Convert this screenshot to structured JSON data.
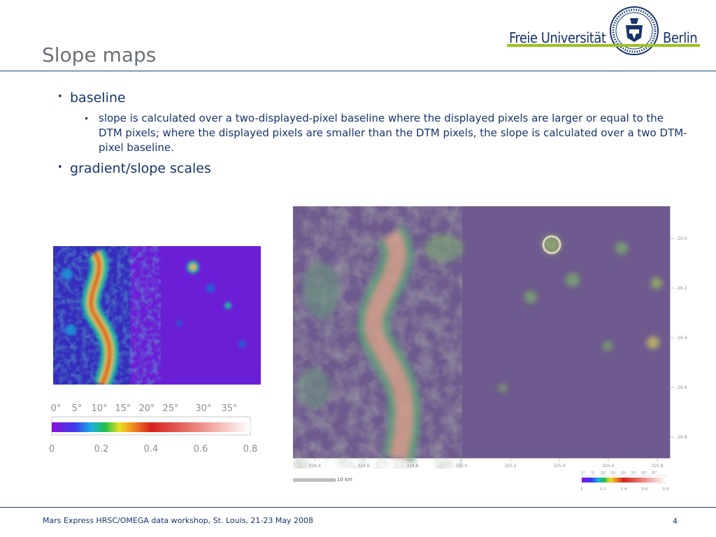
{
  "slide": {
    "title": "Slope maps",
    "bullets": [
      {
        "text": "baseline",
        "sub": [
          "slope is calculated over a two-displayed-pixel baseline where the displayed pixels are larger or equal to the DTM pixels; where the displayed pixels are smaller than the DTM pixels, the slope is calculated over a two DTM-pixel baseline."
        ]
      },
      {
        "text": "gradient/slope scales"
      }
    ],
    "bullet_glyph": "•"
  },
  "logo": {
    "left_word": "Freie Universität",
    "right_word": "Berlin",
    "seal_icon": "university-seal-icon"
  },
  "scale": {
    "degree_labels": [
      "0°",
      "5°",
      "10°",
      "15°",
      "20°",
      "25°",
      "30°",
      "35°"
    ],
    "gradient_labels": [
      "0",
      "0.2",
      "0.4",
      "0.6",
      "0.8"
    ]
  },
  "map": {
    "y_ticks": [
      "-26.0",
      "-26.2",
      "-26.4",
      "-26.6",
      "-26.8"
    ],
    "x_ticks": [
      "324.4",
      "324.6",
      "324.8",
      "325.0",
      "325.2",
      "325.4",
      "325.6",
      "325.8"
    ],
    "scalebar_label": "10 km"
  },
  "footer": {
    "text": "Mars Express HRSC/OMEGA data workshop, St. Louis, 21-23 May 2008",
    "page": "4"
  },
  "colors": {
    "title_grey": "#6b7079",
    "navy": "#16346b",
    "logo_green": "#9bc31f",
    "map_purple": "#6e5a8e",
    "slope_purple": "#6a1fd6"
  }
}
